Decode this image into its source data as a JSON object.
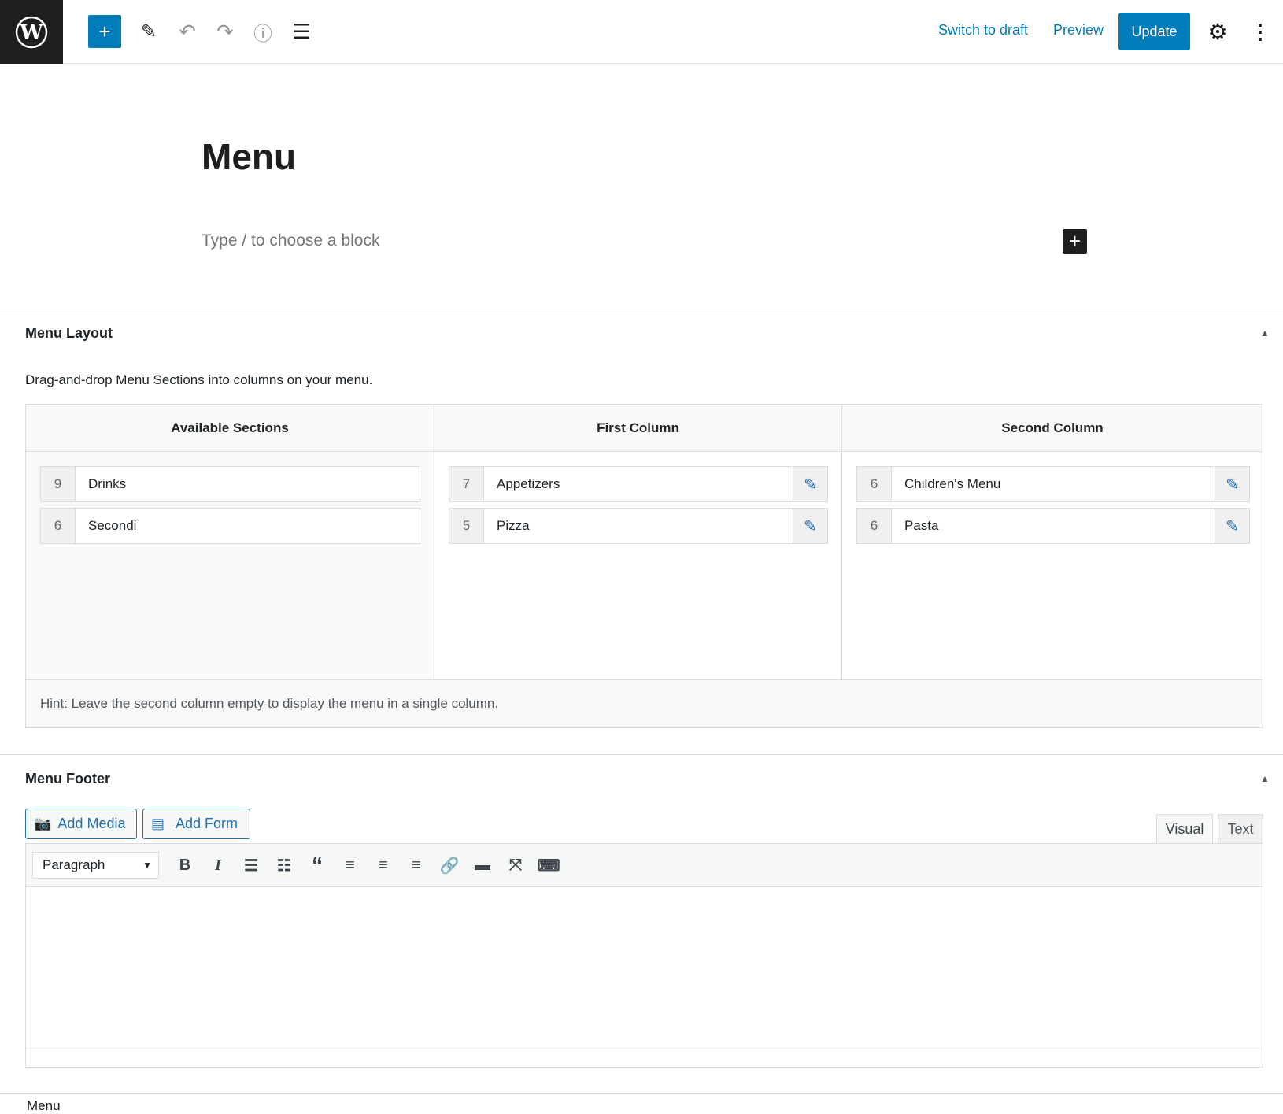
{
  "header": {
    "switch_to_draft": "Switch to draft",
    "preview": "Preview",
    "update": "Update"
  },
  "post": {
    "title": "Menu",
    "block_placeholder": "Type / to choose a block"
  },
  "menu_layout": {
    "heading": "Menu Layout",
    "description": "Drag-and-drop Menu Sections into columns on your menu.",
    "columns": [
      {
        "title": "Available Sections",
        "items": [
          {
            "count": "9",
            "name": "Drinks"
          },
          {
            "count": "6",
            "name": "Secondi"
          }
        ]
      },
      {
        "title": "First Column",
        "items": [
          {
            "count": "7",
            "name": "Appetizers"
          },
          {
            "count": "5",
            "name": "Pizza"
          }
        ]
      },
      {
        "title": "Second Column",
        "items": [
          {
            "count": "6",
            "name": "Children's Menu"
          },
          {
            "count": "6",
            "name": "Pasta"
          }
        ]
      }
    ],
    "hint": "Hint: Leave the second column empty to display the menu in a single column."
  },
  "menu_footer": {
    "heading": "Menu Footer",
    "add_media": "Add Media",
    "add_form": "Add Form",
    "tab_visual": "Visual",
    "tab_text": "Text",
    "format_select": "Paragraph"
  },
  "breadcrumb": "Menu",
  "colors": {
    "accent": "#007cba",
    "dark": "#1e1e1e"
  }
}
